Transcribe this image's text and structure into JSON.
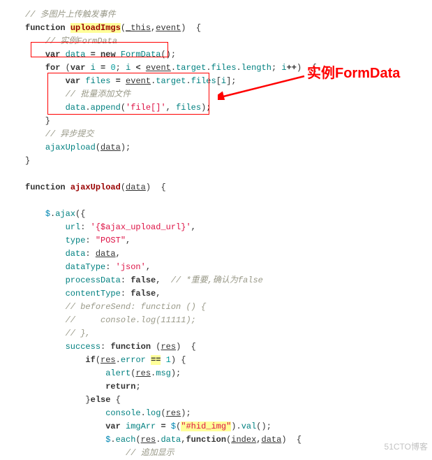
{
  "annotation": {
    "label": "实例FormData"
  },
  "watermark": "51CTO博客",
  "code": {
    "l1": "// 多图片上传触发事件",
    "l3": "// 实例FormData",
    "l7": "// 批量添加文件",
    "l10": "// 异步提交",
    "l22b": "// *重要,确认为false",
    "l24": "// beforeSend: function () {",
    "l25": "//     console.log(11111);",
    "l26": "// },",
    "l36": "// 追加显示",
    "kw": {
      "function": "function",
      "var": "var",
      "new": "new",
      "for": "for",
      "false": "false",
      "if": "if",
      "return": "return",
      "else": "else"
    },
    "fn1": "uploadImgs",
    "fn2": "ajaxUpload",
    "p1": "_this",
    "p2": "event",
    "n0": "0",
    "n1": "1",
    "op": {
      "eqeq": "=="
    },
    "v": {
      "data": "data",
      "FormData": "FormData",
      "i": "i",
      "target": "target",
      "files": "files",
      "length": "length",
      "append": "append",
      "ajaxUpload": "ajaxUpload",
      "dollar": "$",
      "ajax": "ajax",
      "url": "url",
      "type": "type",
      "dataType": "dataType",
      "processData": "processData",
      "contentType": "contentType",
      "success": "success",
      "res": "res",
      "error": "error",
      "alert": "alert",
      "msg": "msg",
      "console": "console",
      "log": "log",
      "imgArr": "imgArr",
      "val": "val",
      "each": "each",
      "index": "index"
    },
    "s": {
      "filearr": "'file[]'",
      "ajaxurl": "'{$ajax_upload_url}'",
      "post": "\"POST\"",
      "json": "'json'",
      "hidimg": "\"#hid_img\""
    }
  }
}
